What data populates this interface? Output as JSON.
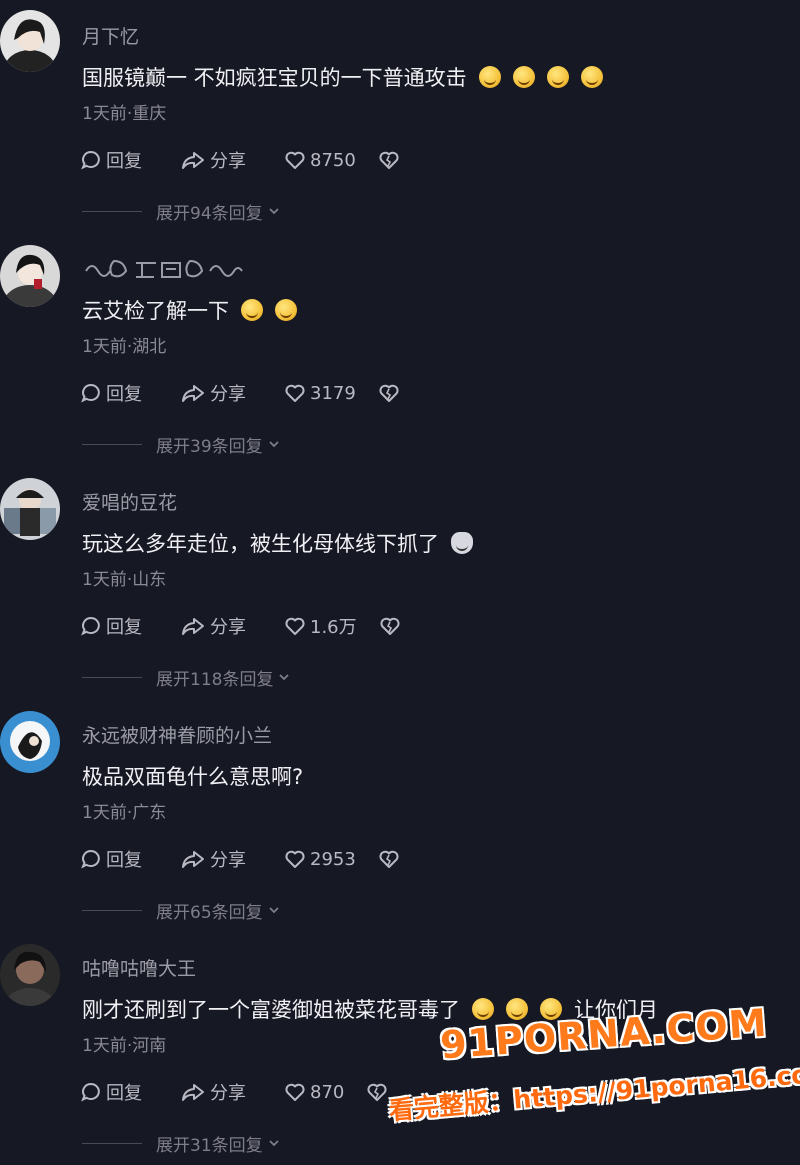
{
  "comments": [
    {
      "username": "月下忆",
      "text": "国服镜巅一 不如疯狂宝贝的一下普通攻击",
      "emoji_icons": [
        "laughing-face-icon",
        "laughing-face-icon",
        "laughing-face-icon",
        "laughing-face-icon"
      ],
      "meta": "1天前·重庆",
      "reply_label": "回复",
      "share_label": "分享",
      "likes": "8750",
      "replies_label": "展开94条回复"
    },
    {
      "username": "",
      "username_is_decorative": true,
      "text": "云艾检了解一下",
      "emoji_icons": [
        "thinking-face-icon",
        "thinking-face-icon"
      ],
      "meta": "1天前·湖北",
      "reply_label": "回复",
      "share_label": "分享",
      "likes": "3179",
      "replies_label": "展开39条回复"
    },
    {
      "username": "爱唱的豆花",
      "text": "玩这么多年走位，被生化母体线下抓了",
      "emoji_icons": [
        "cat-face-icon"
      ],
      "meta": "1天前·山东",
      "reply_label": "回复",
      "share_label": "分享",
      "likes": "1.6万",
      "replies_label": "展开118条回复"
    },
    {
      "username": "永远被财神眷顾的小兰",
      "text": "极品双面龟什么意思啊?",
      "emoji_icons": [],
      "meta": "1天前·广东",
      "reply_label": "回复",
      "share_label": "分享",
      "likes": "2953",
      "replies_label": "展开65条回复"
    },
    {
      "username": "咕噜咕噜大王",
      "text": "刚才还刷到了一个富婆御姐被菜花哥毒了",
      "emoji_icons": [
        "crying-face-icon",
        "crying-face-icon",
        "crying-face-icon"
      ],
      "text_tail": "让你们月",
      "meta": "1天前·河南",
      "reply_label": "回复",
      "share_label": "分享",
      "likes": "870",
      "replies_label": "展开31条回复"
    }
  ],
  "watermark": {
    "logo": "91PORNA.COM",
    "line2": "看完整版：https://91porna16.com"
  },
  "colors": {
    "background": "#161823",
    "watermark": "#ff7a1a"
  }
}
